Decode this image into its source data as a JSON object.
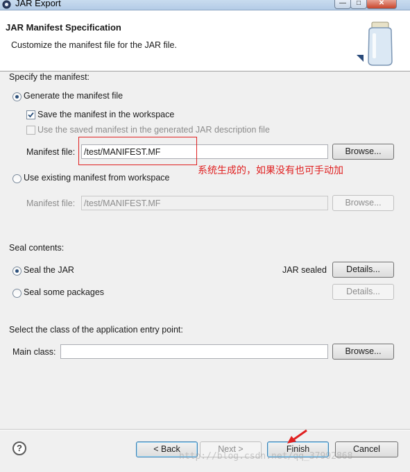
{
  "window": {
    "title": "JAR Export",
    "min_label": "—",
    "max_label": "□",
    "close_label": "✕"
  },
  "banner": {
    "title": "JAR Manifest Specification",
    "description": "Customize the manifest file for the JAR file."
  },
  "manifest": {
    "section_label": "Specify the manifest:",
    "generate_label": "Generate the manifest file",
    "save_in_workspace_label": "Save the manifest in the workspace",
    "use_saved_label": "Use the saved manifest in the generated JAR description file",
    "manifest_file_label": "Manifest file:",
    "manifest_file_value": "/test/MANIFEST.MF",
    "browse_label": "Browse...",
    "use_existing_label": "Use existing manifest from workspace",
    "existing_file_label": "Manifest file:",
    "existing_file_value": "/test/MANIFEST.MF",
    "existing_browse_label": "Browse..."
  },
  "annotation": "系统生成的，如果没有也可手动加",
  "seal": {
    "section_label": "Seal contents:",
    "seal_jar_label": "Seal the JAR",
    "jar_sealed_label": "JAR sealed",
    "details_label": "Details...",
    "seal_packages_label": "Seal some packages",
    "packages_details_label": "Details..."
  },
  "entry": {
    "section_label": "Select the class of the application entry point:",
    "main_class_label": "Main class:",
    "main_class_value": "",
    "browse_label": "Browse..."
  },
  "footer": {
    "help_label": "?",
    "back_label": "< Back",
    "next_label": "Next >",
    "finish_label": "Finish",
    "cancel_label": "Cancel"
  },
  "watermark": "http://blog.csdn.net/qq_37992868",
  "colors": {
    "annotation_red": "#e02020",
    "banner_bg": "#ffffff",
    "dialog_bg": "#f0f0f0"
  }
}
